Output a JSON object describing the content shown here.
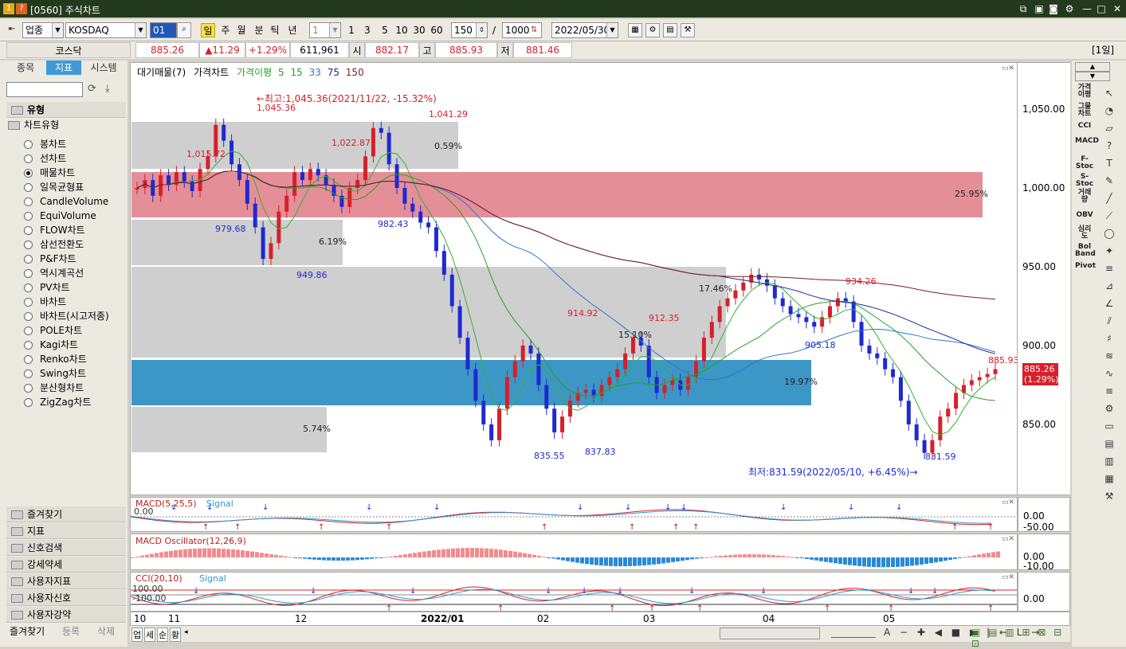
{
  "title": {
    "badge1": "1",
    "badge2": "?",
    "text": "[0560] 주식차트"
  },
  "toolbar": {
    "market_type": "업종",
    "market_name": "KOSDAQ",
    "code": "01",
    "periods": [
      "일",
      "주",
      "월",
      "분",
      "틱",
      "년"
    ],
    "interval": "1",
    "presets": [
      "1",
      "3",
      "5",
      "10",
      "30",
      "60"
    ],
    "count": "150",
    "total": "1000",
    "date": "2022/05/30"
  },
  "quote": {
    "name": "코스닥",
    "price": "885.26",
    "change": "▲11.29",
    "rate": "+1.29%",
    "volume": "611,961",
    "open_label": "시",
    "open": "882.17",
    "high_label": "고",
    "high": "885.93",
    "low_label": "저",
    "low": "881.46",
    "period_badge": "[1일]"
  },
  "left": {
    "tabs": [
      "종목",
      "지표",
      "시스템"
    ],
    "header": "유형",
    "group": "차트유형",
    "types": [
      "봉차트",
      "선차트",
      "매물차트",
      "일목균형표",
      "CandleVolume",
      "EquiVolume",
      "FLOW차트",
      "삼선전환도",
      "P&F차트",
      "역시계곡선",
      "PV차트",
      "바차트",
      "바차트(시고저종)",
      "POLE차트",
      "Kagi차트",
      "Renko차트",
      "Swing차트",
      "분산형차트",
      "ZigZag차트"
    ],
    "selected_type": "매물차트",
    "sections": [
      "즐겨찾기",
      "지표",
      "신호검색",
      "강세약세",
      "사용자지표",
      "사용자신호",
      "사용자강약"
    ],
    "footer": [
      "즐겨찾기",
      "등록",
      "삭제"
    ]
  },
  "legend": {
    "items": [
      "대기매물(7)",
      "가격차트",
      "가격이평",
      "5",
      "15",
      "33",
      "75",
      "150"
    ]
  },
  "annotations": {
    "high": "←최고:1,045.36(2021/11/22, -15.32%)",
    "low": "최저:831.59(2022/05/10, +6.45%)→",
    "labels": [
      "1,045.36",
      "1,041.29",
      "1,015.72",
      "1,022.87",
      "979.68",
      "949.86",
      "982.43",
      "914.92",
      "912.35",
      "835.55",
      "837.83",
      "934.26",
      "905.18",
      "831.59",
      "885.93"
    ],
    "percents": [
      "25.95%",
      "6.19%",
      "17.46%",
      "15.10%",
      "19.97%",
      "5.74%",
      "0.59%"
    ],
    "last_price": "885.26",
    "last_rate": "(1.29%)"
  },
  "yaxis": {
    "ticks": [
      "1,050.00",
      "1,000.00",
      "950.00",
      "900.00",
      "850.00"
    ]
  },
  "macd": {
    "title": "MACD(5,25,5)",
    "signal": "Signal",
    "ticks": [
      "0.00",
      "-50.00"
    ],
    "left_val": "0.00"
  },
  "osc": {
    "title": "MACD Oscillator(12,26,9)",
    "ticks": [
      "0.00",
      "-10.00"
    ]
  },
  "cci": {
    "title": "CCI(20,10)",
    "signal": "Signal",
    "ticks": [
      "0.00"
    ],
    "upper": "100.00",
    "lower": "-100.00"
  },
  "xaxis": {
    "ticks": [
      "10",
      "11",
      "12",
      "2022/01",
      "02",
      "03",
      "04",
      "05"
    ]
  },
  "bottom": {
    "tabs": [
      "업",
      "세",
      "순",
      "황"
    ]
  },
  "right": {
    "labels": [
      "가격이평",
      "그물차트",
      "CCI",
      "MACD",
      "F-Stoc",
      "S-Stoc",
      "거래량",
      "OBV",
      "심리도",
      "Bol Band",
      "Pivot"
    ]
  },
  "colors": {
    "up": "#d6202a",
    "down": "#1e2ad0",
    "blue_zone": "#3d97c6",
    "pink_zone": "#e48f98",
    "gray_zone": "#cfcfcf"
  }
}
